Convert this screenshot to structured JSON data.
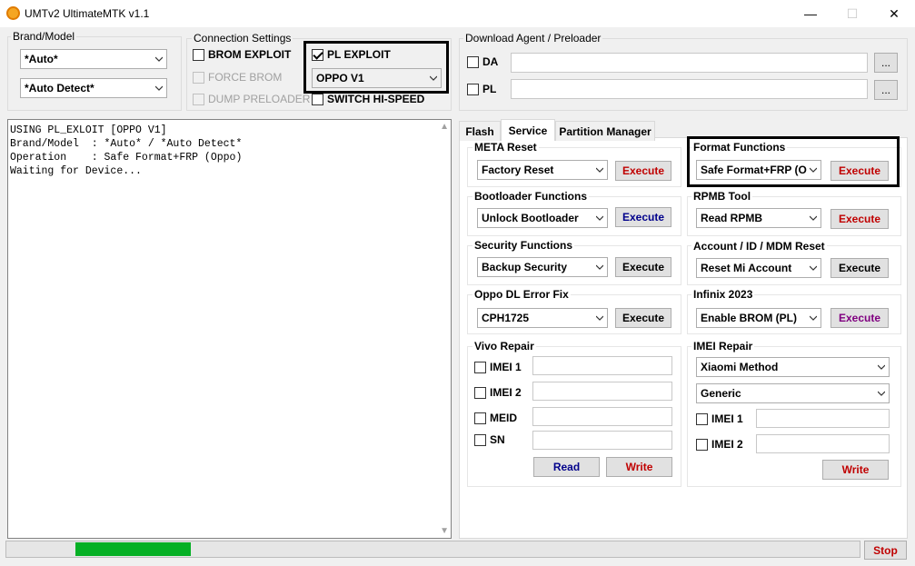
{
  "window": {
    "title": "UMTv2 UltimateMTK v1.1",
    "minimize": "—",
    "maximize": "☐",
    "close": "✕"
  },
  "brand_model": {
    "label": "Brand/Model",
    "brand_value": "*Auto*",
    "model_value": "*Auto Detect*"
  },
  "connection": {
    "label": "Connection Settings",
    "brom_exploit": "BROM EXPLOIT",
    "force_brom": "FORCE BROM",
    "dump_preloader": "DUMP PRELOADER",
    "pl_exploit": "PL EXPLOIT",
    "pl_exploit_value": "OPPO V1",
    "switch_hispeed": "SWITCH HI-SPEED"
  },
  "download_agent": {
    "label": "Download Agent / Preloader",
    "da": "DA",
    "pl": "PL",
    "browse": "..."
  },
  "log": {
    "lines": "USING PL_EXLOIT [OPPO V1]\nBrand/Model  : *Auto* / *Auto Detect*\nOperation    : Safe Format+FRP (Oppo)\nWaiting for Device..."
  },
  "tabs": [
    "Flash",
    "Service",
    "Partition Manager"
  ],
  "service": {
    "meta_reset": {
      "label": "META Reset",
      "value": "Factory Reset",
      "button": "Execute"
    },
    "format_functions": {
      "label": "Format Functions",
      "value": "Safe Format+FRP (O",
      "button": "Execute"
    },
    "bootloader": {
      "label": "Bootloader Functions",
      "value": "Unlock Bootloader",
      "button": "Execute"
    },
    "rpmb": {
      "label": "RPMB Tool",
      "value": "Read RPMB",
      "button": "Execute"
    },
    "security": {
      "label": "Security Functions",
      "value": "Backup Security",
      "button": "Execute"
    },
    "account": {
      "label": "Account / ID / MDM Reset",
      "value": "Reset Mi Account",
      "button": "Execute"
    },
    "oppo_dl": {
      "label": "Oppo DL Error Fix",
      "value": "CPH1725",
      "button": "Execute"
    },
    "infinix": {
      "label": "Infinix 2023",
      "value": "Enable BROM (PL)",
      "button": "Execute"
    },
    "vivo": {
      "label": "Vivo Repair",
      "imei1": "IMEI 1",
      "imei2": "IMEI 2",
      "meid": "MEID",
      "sn": "SN",
      "read": "Read",
      "write": "Write"
    },
    "imei_repair": {
      "label": "IMEI Repair",
      "method": "Xiaomi Method",
      "mode": "Generic",
      "imei1": "IMEI 1",
      "imei2": "IMEI 2",
      "write": "Write"
    }
  },
  "progress": {
    "fraction": 0.135
  },
  "stop_button": "Stop",
  "colors": {
    "progress": "#06b025",
    "execute_red": "#c00000",
    "execute_blue": "#00008b",
    "execute_purple": "#800080"
  }
}
